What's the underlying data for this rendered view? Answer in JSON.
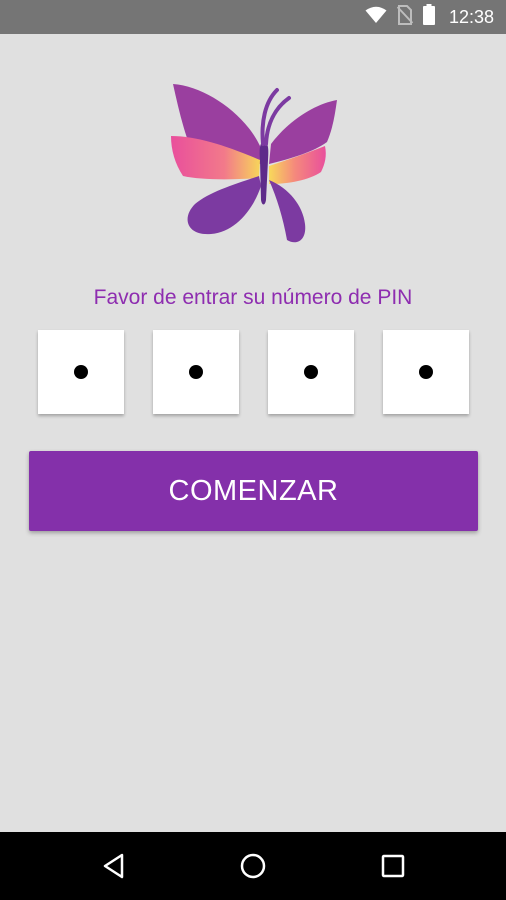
{
  "status_bar": {
    "time": "12:38",
    "icons": [
      "wifi-icon",
      "no-sim-icon",
      "battery-icon"
    ],
    "background": "#757575"
  },
  "logo": {
    "name": "butterfly-logo",
    "colors": [
      "#8a3fa5",
      "#ec5fa2",
      "#f7d85c"
    ]
  },
  "login": {
    "prompt": "Favor de entrar su número de PIN",
    "pin_digits": [
      "•",
      "•",
      "•",
      "•"
    ],
    "button_label": "COMENZAR",
    "accent": "#8430aa"
  },
  "nav_bar": {
    "buttons": [
      "back-icon",
      "home-icon",
      "recents-icon"
    ]
  }
}
